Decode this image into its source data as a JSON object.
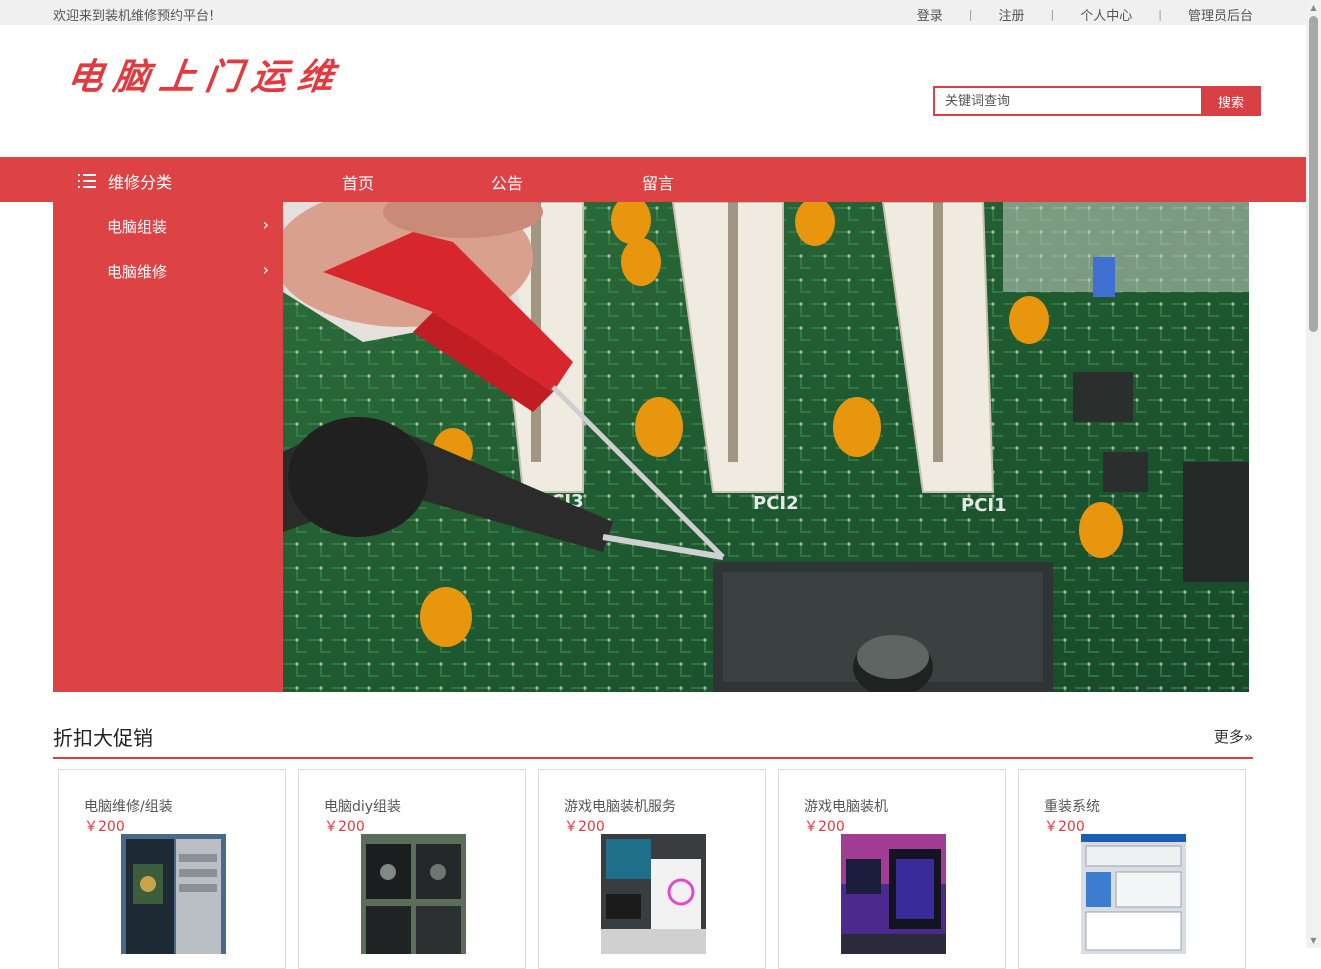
{
  "topbar": {
    "welcome": "欢迎来到装机维修预约平台!",
    "links": [
      "登录",
      "注册",
      "个人中心",
      "管理员后台"
    ]
  },
  "logo": {
    "text": "电脑上门运维"
  },
  "search": {
    "placeholder": "关键词查询",
    "button": "搜索"
  },
  "nav": {
    "category_title": "维修分类",
    "links": [
      "首页",
      "公告",
      "留言"
    ]
  },
  "sidebar": {
    "items": [
      "电脑组装",
      "电脑维修"
    ]
  },
  "promo": {
    "title": "折扣大促销",
    "more": "更多»",
    "products": [
      {
        "name": "电脑维修/组装",
        "price": "￥200"
      },
      {
        "name": "电脑diy组装",
        "price": "￥200"
      },
      {
        "name": "游戏电脑装机服务",
        "price": "￥200"
      },
      {
        "name": "游戏电脑装机",
        "price": "￥200"
      },
      {
        "name": "重装系统",
        "price": "￥200"
      }
    ]
  },
  "colors": {
    "accent": "#dd4245",
    "price": "#e23a3f",
    "topbar_bg": "#f0f0f0"
  },
  "icons": {
    "category": "list-icon",
    "submenu": "chevron-right-icon"
  }
}
